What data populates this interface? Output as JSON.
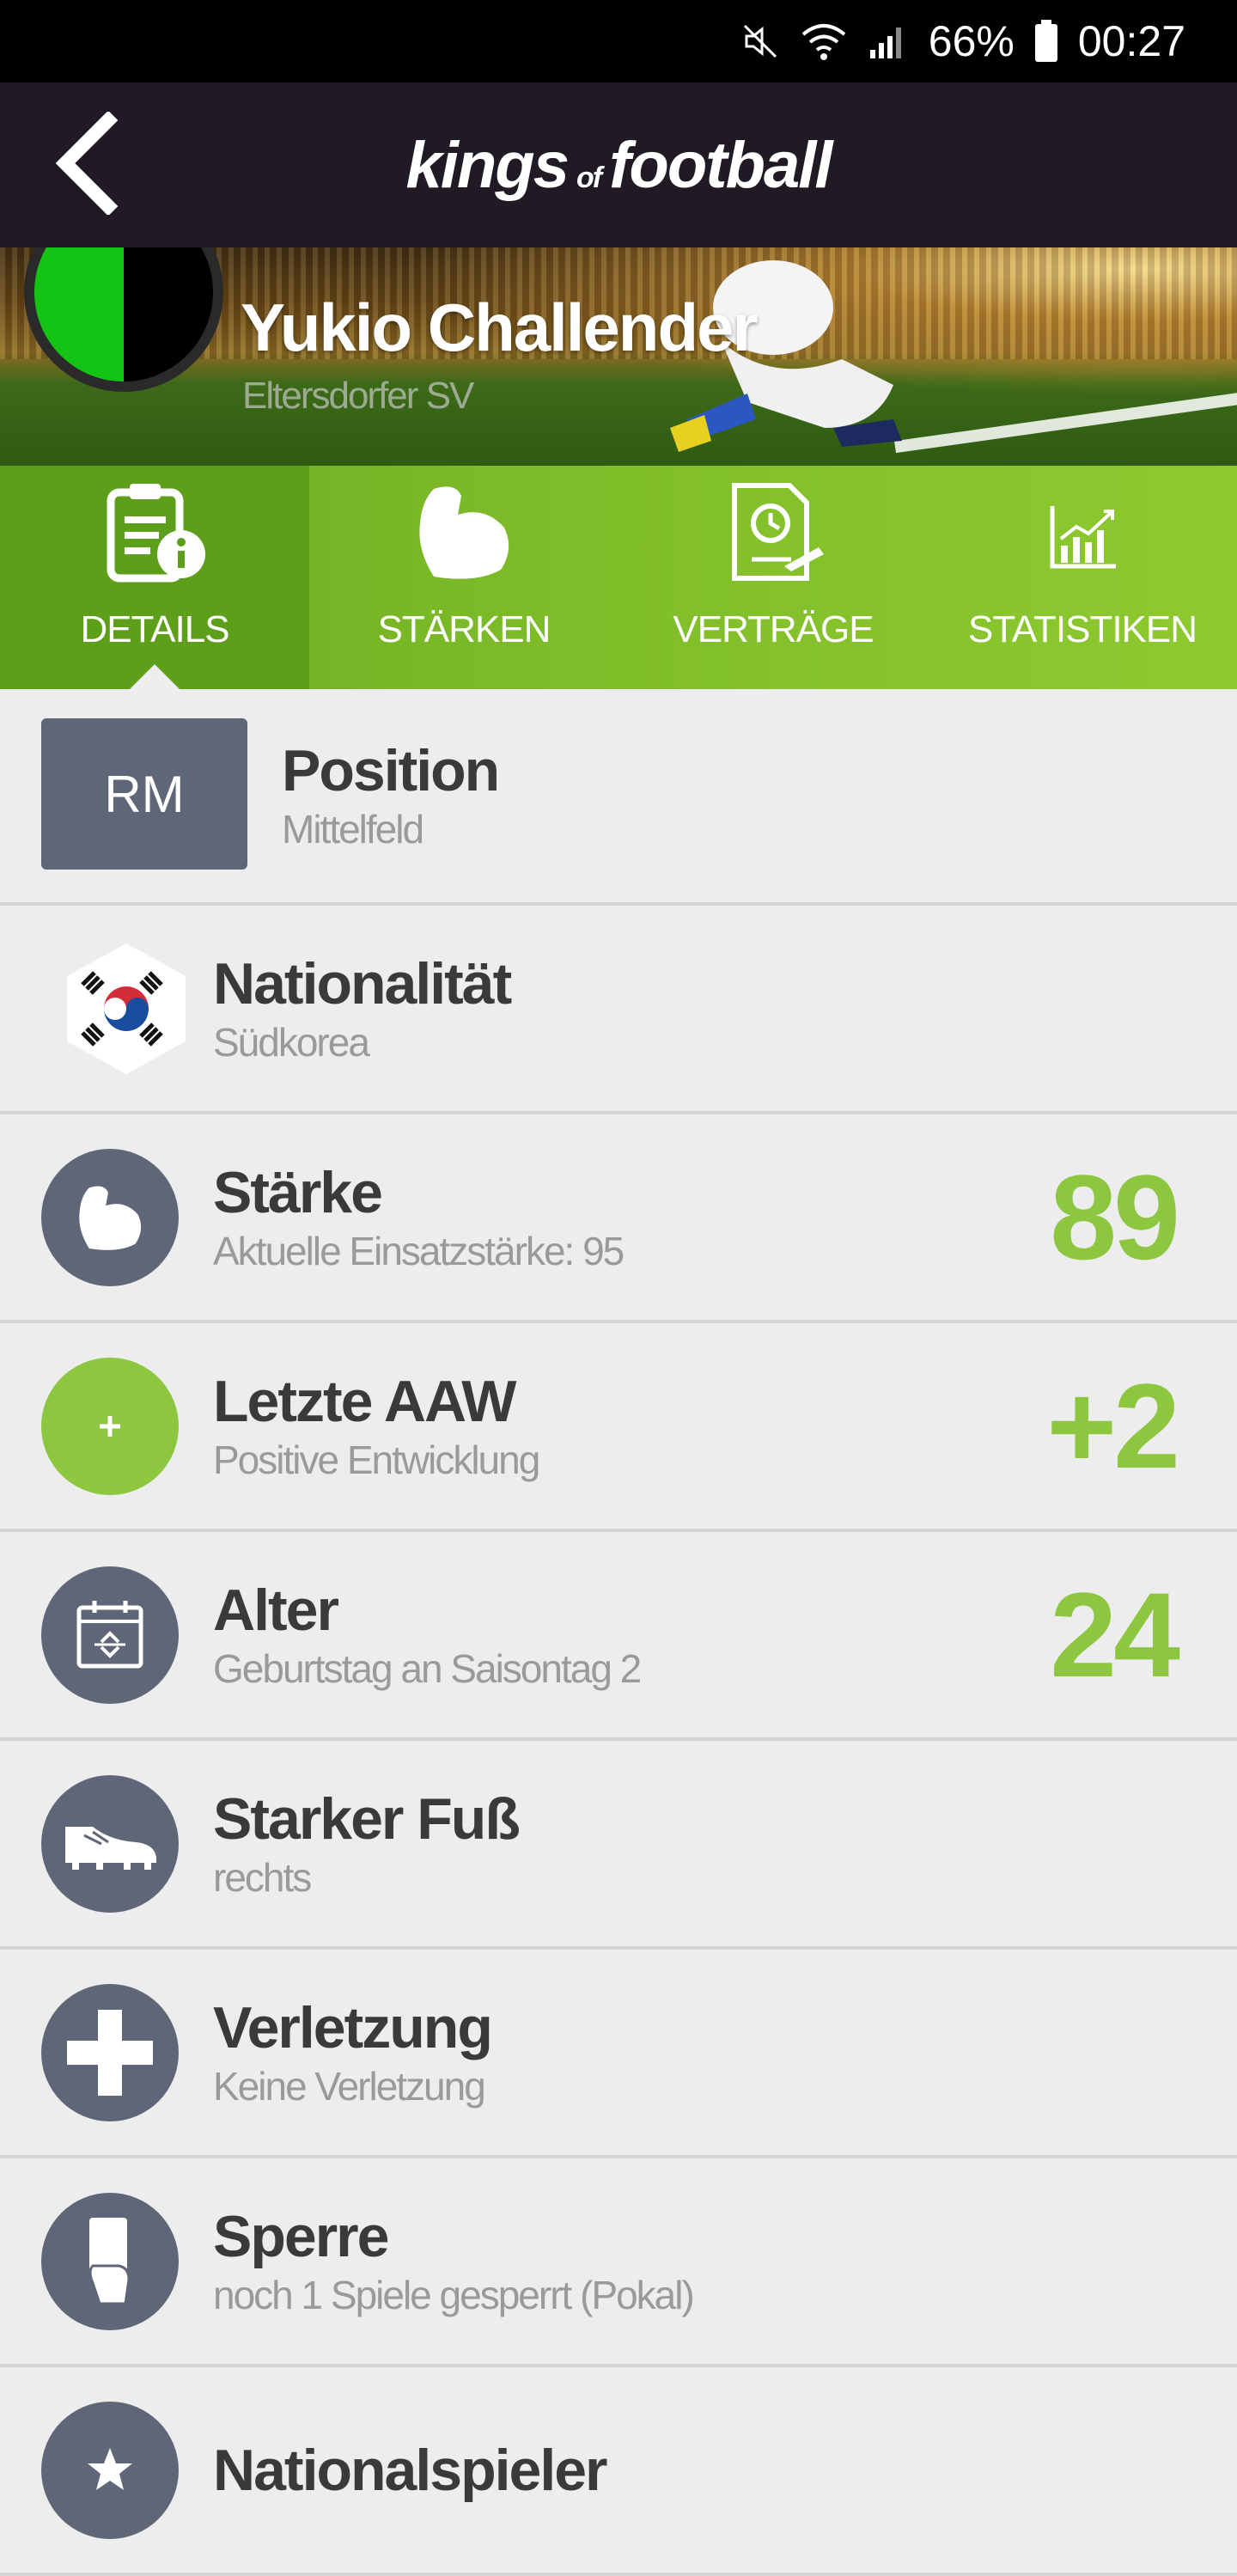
{
  "status_bar": {
    "battery": "66%",
    "time": "00:27",
    "icons": [
      "mute-icon",
      "wifi-icon",
      "signal-icon",
      "battery-icon"
    ]
  },
  "header": {
    "brand_part1": "kings",
    "brand_of": "of",
    "brand_part2": "football",
    "back_icon": "chevron-left-icon"
  },
  "player": {
    "name": "Yukio Challender",
    "club": "Eltersdorfer SV"
  },
  "tabs": [
    {
      "label": "DETAILS",
      "icon": "details-icon",
      "active": true
    },
    {
      "label": "STÄRKEN",
      "icon": "biceps-icon",
      "active": false
    },
    {
      "label": "VERTRÄGE",
      "icon": "contract-icon",
      "active": false
    },
    {
      "label": "STATISTIKEN",
      "icon": "chart-icon",
      "active": false
    }
  ],
  "details": {
    "position": {
      "badge": "RM",
      "title": "Position",
      "sub": "Mittelfeld"
    },
    "nationality": {
      "title": "Nationalität",
      "sub": "Südkorea",
      "icon": "korea-flag-icon"
    },
    "strength": {
      "title": "Stärke",
      "sub": "Aktuelle Einsatzstärke: 95",
      "value": "89",
      "icon": "biceps-icon"
    },
    "last_aaw": {
      "title": "Letzte AAW",
      "sub": "Positive Entwicklung",
      "value": "+2",
      "icon": "plus-icon"
    },
    "age": {
      "title": "Alter",
      "sub": "Geburtstag an Saisontag 2",
      "value": "24",
      "icon": "calendar-icon"
    },
    "foot": {
      "title": "Starker Fuß",
      "sub": "rechts",
      "icon": "boot-icon"
    },
    "injury": {
      "title": "Verletzung",
      "sub": "Keine Verletzung",
      "icon": "cross-icon"
    },
    "suspension": {
      "title": "Sperre",
      "sub": "noch 1 Spiele gesperrt (Pokal)",
      "icon": "card-icon"
    },
    "national_player": {
      "title": "Nationalspieler",
      "icon": "star-icon"
    }
  },
  "colors": {
    "accent_green": "#8dc63f",
    "tab_active": "#5d9f1a",
    "icon_bg": "#5f6678",
    "header_bg": "#201a24"
  }
}
